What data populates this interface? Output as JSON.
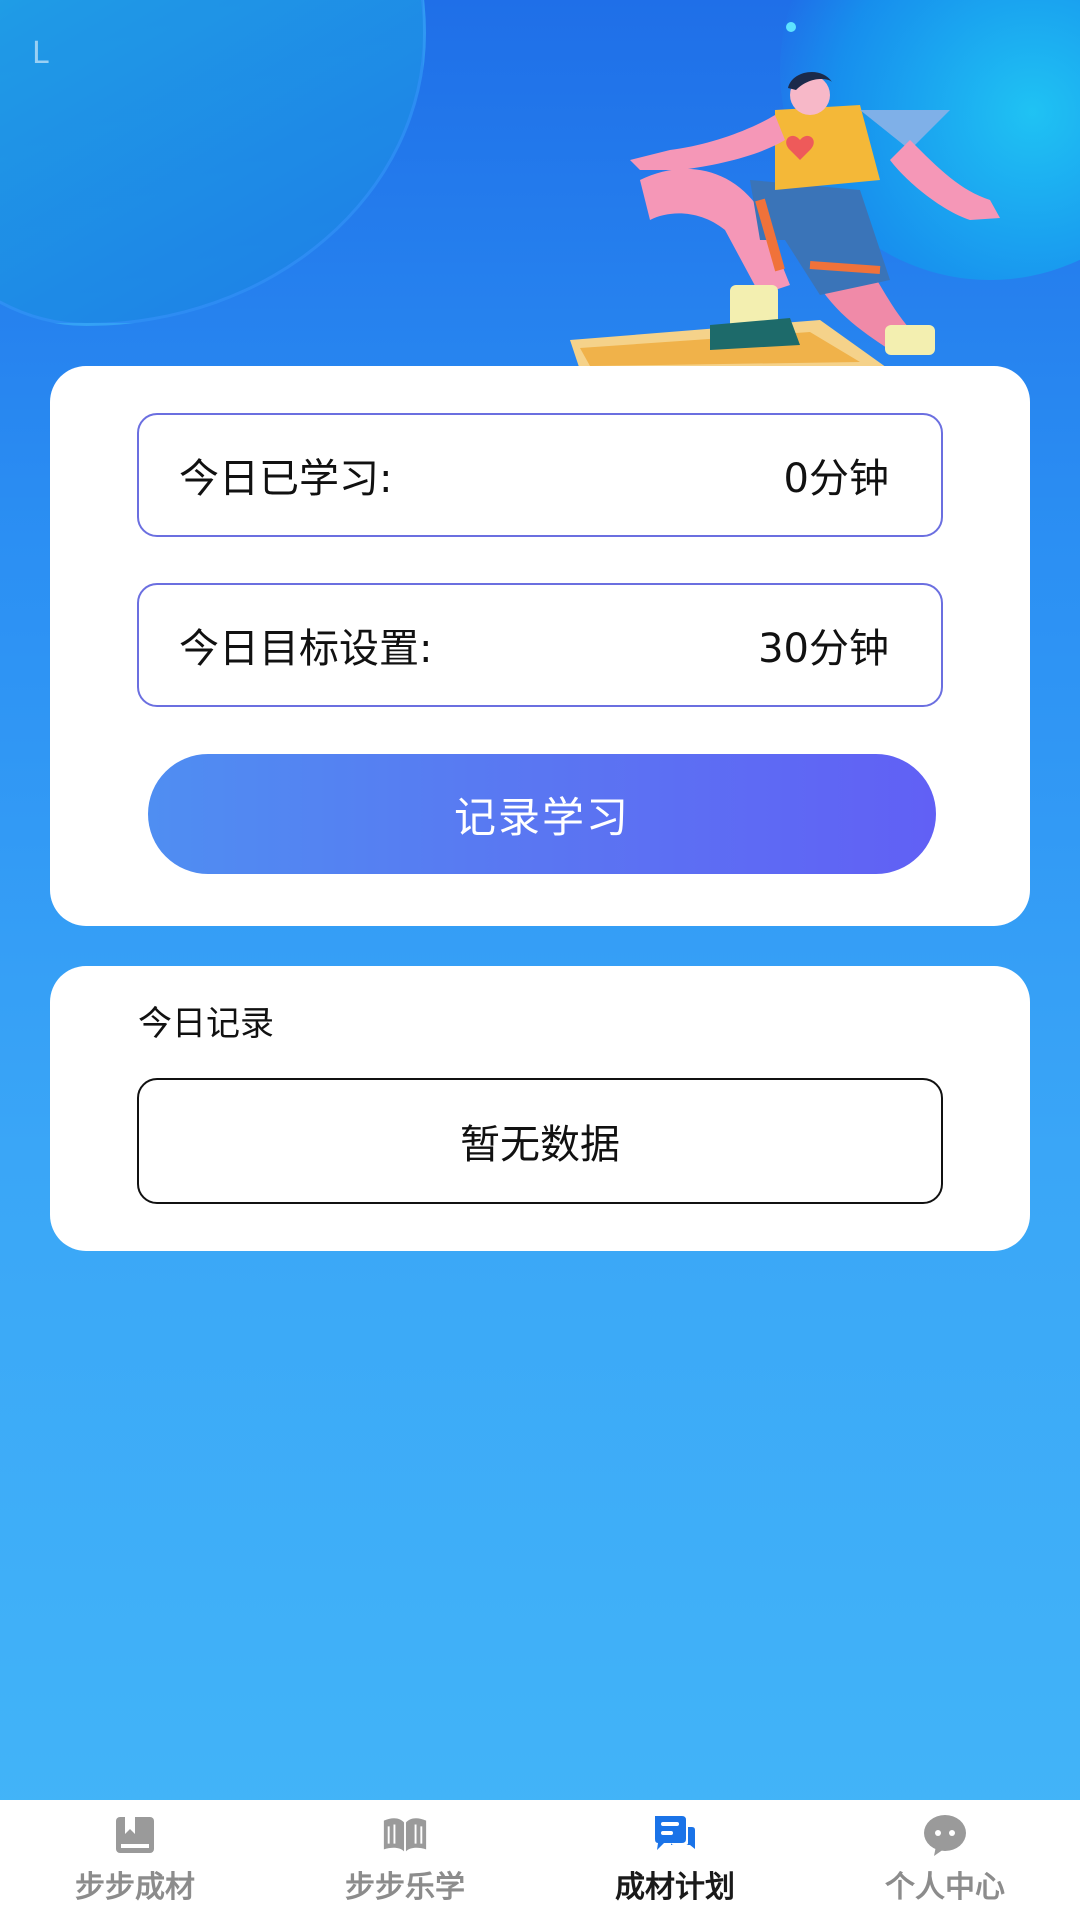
{
  "status_mark": "L",
  "today_card": {
    "studied_label": "今日已学习:",
    "studied_value": "0分钟",
    "goal_label": "今日目标设置:",
    "goal_value": "30分钟",
    "record_button": "记录学习"
  },
  "records_card": {
    "title": "今日记录",
    "empty_text": "暂无数据"
  },
  "tabbar": {
    "active_color": "#1a73e8",
    "inactive_color": "#9a9a9a",
    "items": [
      {
        "label": "步步成材",
        "icon": "bookmark-book-icon",
        "active": false
      },
      {
        "label": "步步乐学",
        "icon": "open-book-icon",
        "active": false
      },
      {
        "label": "成材计划",
        "icon": "chat-plan-icon",
        "active": true
      },
      {
        "label": "个人中心",
        "icon": "chat-bubble-icon",
        "active": false
      }
    ]
  }
}
